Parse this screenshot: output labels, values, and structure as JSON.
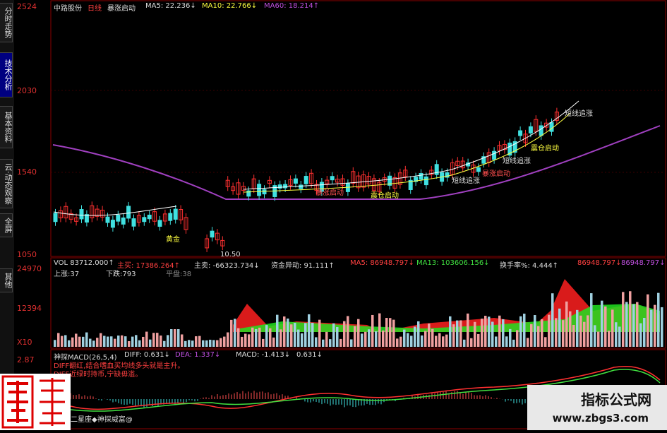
{
  "header": {
    "stock_name": "中路股份",
    "period": "日线",
    "indicator": "暴涨启动",
    "ma5": "MA5: 22.236↓",
    "ma10": "MA10: 22.766↓",
    "ma60": "MA60: 18.214↑"
  },
  "sidebar": {
    "tabs": [
      {
        "label": "分时走势"
      },
      {
        "label": "技术分析"
      },
      {
        "label": "基本资料"
      },
      {
        "label": "云·动态观察"
      },
      {
        "label": "全屏"
      },
      {
        "label": "其他"
      }
    ]
  },
  "price_axis": {
    "labels": [
      "2524",
      "2030",
      "1540",
      "1050"
    ]
  },
  "annotations": {
    "low_price": "10.50",
    "gold": "黄金",
    "signals": [
      "暴涨启动",
      "震仓启动",
      "短线追涨",
      "短线追涨",
      "暴涨启动",
      "震仓启动",
      "短线追涨",
      "震仓启动"
    ]
  },
  "volume_panel": {
    "vol_label": "VOL 83712.000↑",
    "main_buy": "主买: 17386.264↑",
    "main_sell": "主卖: -66323.734↓",
    "fund_flow": "资金异动: 91.111↑",
    "ma5": "MA5: 86948.797↓",
    "ma13": "MA13: 103606.156↓",
    "turnover": "换手率%: 4.444↑",
    "extra1": "86948.797↓",
    "extra2": "86948.797↓",
    "up_count": "上涨:37",
    "down_count": "下跌:793",
    "flat_count": "平盘:38",
    "axis": [
      "24970",
      "12394",
      "X10"
    ]
  },
  "macd_panel": {
    "title": "神探MACD(26,5,4)",
    "diff": "DIFF: 0.631↓",
    "dea": "DEA: 1.337↓",
    "macd": "MACD: -1.413↓",
    "val": "0.631↓",
    "note1": "DIFF翻红,结合嗜血买均线多头就是主升。",
    "note2": "DIFF近绿时持币,宁缺毋滥。",
    "axis_top": "2.87",
    "footer": "二星座◆神探威富@"
  },
  "watermark": {
    "title": "指标公式网",
    "url": "www.zbgs3.com"
  },
  "colors": {
    "up": "#ff3030",
    "down": "#40e0e0",
    "ma5": "#ffffff",
    "ma10": "#ffff40",
    "ma60": "#a040c0"
  }
}
